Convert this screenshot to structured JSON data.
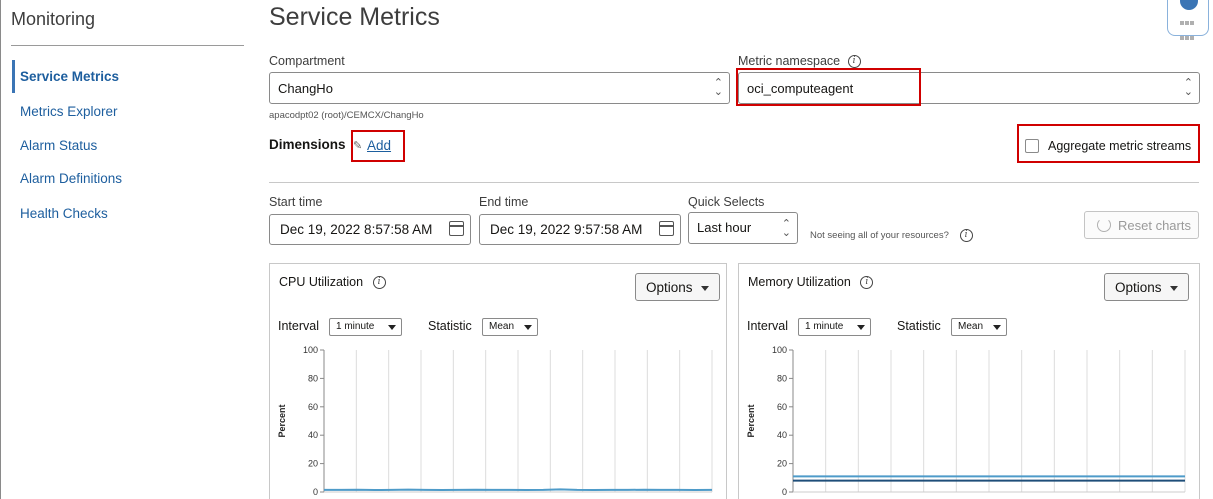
{
  "sidebar": {
    "title": "Monitoring",
    "items": [
      {
        "label": "Service Metrics",
        "active": true
      },
      {
        "label": "Metrics Explorer"
      },
      {
        "label": "Alarm Status"
      },
      {
        "label": "Alarm Definitions"
      },
      {
        "label": "Health Checks"
      }
    ]
  },
  "page": {
    "title": "Service Metrics",
    "compartment_label": "Compartment",
    "compartment_value": "ChangHo",
    "compartment_path": "apacodpt02 (root)/CEMCX/ChangHo",
    "namespace_label": "Metric namespace",
    "namespace_value": "oci_computeagent",
    "dimensions_label": "Dimensions",
    "add_label": "Add",
    "aggregate_label": "Aggregate metric streams",
    "start_label": "Start time",
    "start_value": "Dec 19, 2022 8:57:58 AM",
    "end_label": "End time",
    "end_value": "Dec 19, 2022 9:57:58 AM",
    "quick_label": "Quick Selects",
    "quick_value": "Last hour",
    "not_seeing": "Not seeing all of your resources?",
    "reset_label": "Reset charts"
  },
  "icons": [
    "info-icon",
    "calendar-icon",
    "pencil-icon",
    "reset-icon",
    "chevron-updown-icon",
    "apps-grid-icon"
  ],
  "colors": {
    "accent": "#1d5e9e",
    "series": "#4e9bc9",
    "series_dark": "#1f4e79",
    "highlight": "#d00000"
  },
  "panels": [
    {
      "title": "CPU Utilization",
      "options_label": "Options",
      "interval_label": "Interval",
      "interval_value": "1 minute",
      "statistic_label": "Statistic",
      "statistic_value": "Mean"
    },
    {
      "title": "Memory Utilization",
      "options_label": "Options",
      "interval_label": "Interval",
      "interval_value": "1 minute",
      "statistic_label": "Statistic",
      "statistic_value": "Mean"
    }
  ],
  "chart_data": [
    {
      "type": "line",
      "title": "CPU Utilization",
      "ylabel": "Percent",
      "ylim": [
        0,
        100
      ],
      "yticks": [
        0,
        20,
        40,
        60,
        80,
        100
      ],
      "series": [
        {
          "values": [
            1.5,
            1.5,
            1.6,
            1.4,
            1.5,
            1.7,
            1.5,
            1.4,
            1.5,
            1.6,
            1.5,
            1.5,
            1.4,
            1.5,
            1.8,
            1.5,
            1.4,
            1.5,
            1.5,
            1.6,
            1.5,
            1.5,
            1.4,
            1.5
          ]
        }
      ]
    },
    {
      "type": "line",
      "title": "Memory Utilization",
      "ylabel": "Percent",
      "ylim": [
        0,
        100
      ],
      "yticks": [
        0,
        20,
        40,
        60,
        80,
        100
      ],
      "series": [
        {
          "values": [
            11,
            11,
            11,
            11,
            11,
            11,
            11,
            11,
            11,
            11,
            11,
            11
          ]
        },
        {
          "values": [
            8,
            8,
            8,
            8,
            8,
            8,
            8,
            8,
            8,
            8,
            8,
            8
          ]
        }
      ]
    }
  ]
}
